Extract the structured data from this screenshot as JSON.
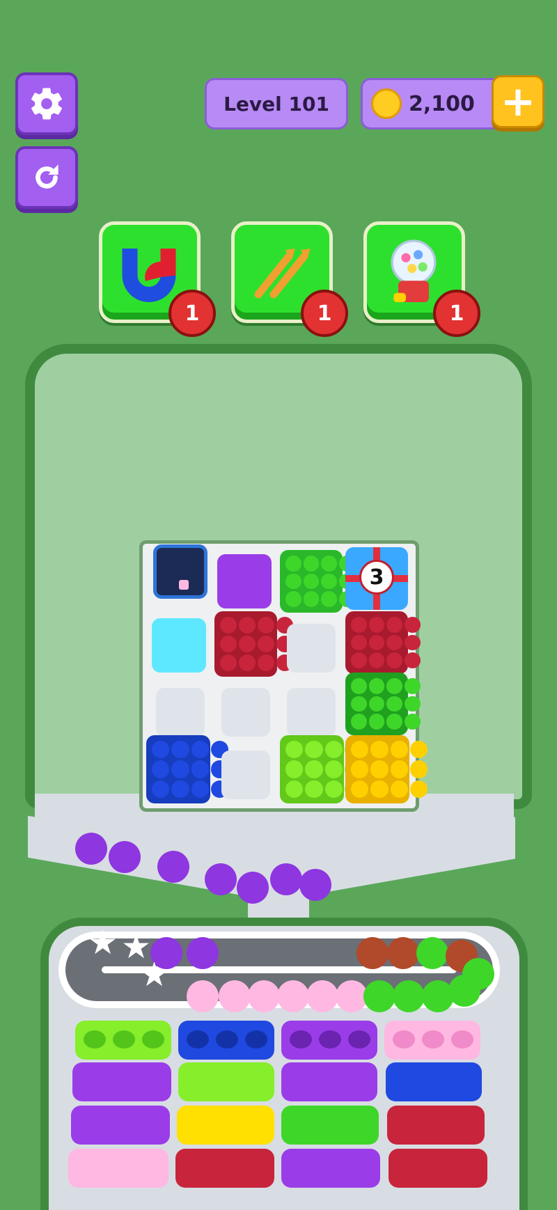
{
  "header": {
    "level_label": "Level 101",
    "coins": "2,100",
    "plus_label": "+"
  },
  "boosters": [
    {
      "name": "magnet",
      "count": "1"
    },
    {
      "name": "shuffle",
      "count": "1"
    },
    {
      "name": "gumball",
      "count": "1"
    }
  ],
  "board": {
    "lock_counter": "3"
  },
  "colors": {
    "green": "#3fd62a",
    "red": "#c8243c",
    "blue": "#1f49e0",
    "yellow": "#ffd000",
    "lime": "#86ee2a",
    "purple": "#9a3de8",
    "cyan": "#5ee8ff",
    "pink": "#ffb8e2"
  }
}
